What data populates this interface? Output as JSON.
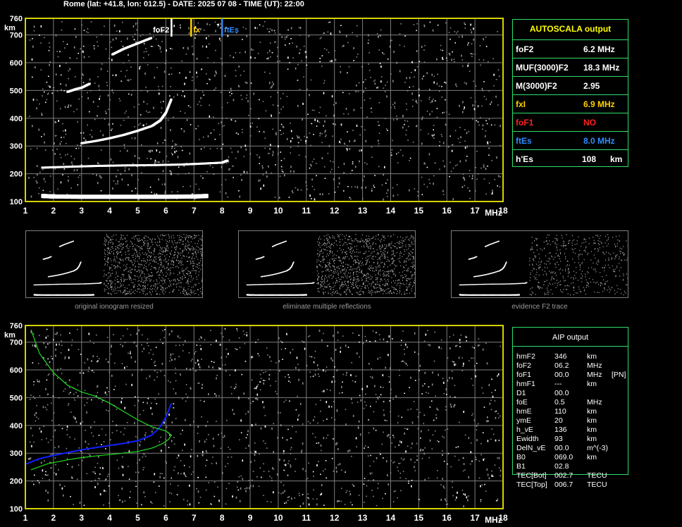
{
  "header": {
    "title": "Rome (lat: +41.8, lon: 012.5) - DATE: 2025 07 08 - TIME (UT): 22:00"
  },
  "colors": {
    "background": "#000000",
    "grid": "#7d7d7d",
    "axis_box": "#d6d200",
    "panel_border": "#2ee06a",
    "autoscala_title": "#ffff00",
    "fxI": "#ffd000",
    "foF1": "#ff2020",
    "ftEs": "#2f8bff",
    "profile_blue": "#1020ff",
    "profile_green": "#20e020",
    "trace": "#ffffff"
  },
  "chart_data": [
    {
      "type": "scatter",
      "name": "autoscala_ionogram",
      "xlabel": "MHz",
      "ylabel": "km",
      "xlim": [
        1,
        18
      ],
      "ylim": [
        100,
        760
      ],
      "xticks": [
        1,
        2,
        3,
        4,
        5,
        6,
        7,
        8,
        9,
        10,
        11,
        12,
        13,
        14,
        15,
        16,
        17,
        18
      ],
      "yticks": [
        100,
        200,
        300,
        400,
        500,
        600,
        700,
        760
      ],
      "grid": true,
      "markers": [
        {
          "label": "foF2",
          "x": 6.2,
          "color": "#ffffff"
        },
        {
          "label": "fx",
          "x": 6.9,
          "color": "#ffd000"
        },
        {
          "label": "ftEs",
          "x": 8.0,
          "color": "#2f8bff"
        }
      ],
      "traces": [
        {
          "name": "E/Es layer",
          "x": [
            1.6,
            2.0,
            3.0,
            4.0,
            5.0,
            6.0,
            7.0,
            7.5
          ],
          "y": [
            120,
            118,
            117,
            117,
            117,
            117,
            118,
            120
          ]
        },
        {
          "name": "Es second hop",
          "x": [
            1.6,
            2.5,
            3.5,
            4.5,
            5.5,
            6.5,
            7.2,
            8.0,
            8.2
          ],
          "y": [
            222,
            225,
            228,
            230,
            231,
            233,
            236,
            240,
            248
          ]
        },
        {
          "name": "F2 ordinary",
          "x": [
            3.0,
            3.5,
            4.0,
            4.5,
            5.0,
            5.5,
            5.8,
            6.0,
            6.2
          ],
          "y": [
            310,
            318,
            328,
            340,
            355,
            372,
            392,
            420,
            470
          ]
        },
        {
          "name": "F2 second hop",
          "x": [
            2.5,
            2.8,
            3.0,
            3.3
          ],
          "y": [
            495,
            505,
            510,
            525
          ]
        },
        {
          "name": "F2 faint high",
          "x": [
            4.1,
            4.5,
            5.0,
            5.5
          ],
          "y": [
            630,
            650,
            670,
            690
          ]
        }
      ]
    },
    {
      "type": "line",
      "name": "aip_profile",
      "xlabel": "MHz",
      "ylabel": "km",
      "xlim": [
        1,
        18
      ],
      "ylim": [
        100,
        760
      ],
      "xticks": [
        1,
        2,
        3,
        4,
        5,
        6,
        7,
        8,
        9,
        10,
        11,
        12,
        13,
        14,
        15,
        16,
        17,
        18
      ],
      "yticks": [
        100,
        200,
        300,
        400,
        500,
        600,
        700,
        760
      ],
      "grid": true,
      "series": [
        {
          "color": "blue",
          "x": [
            1.0,
            1.5,
            2.0,
            2.5,
            3.0,
            3.5,
            4.0,
            4.5,
            5.0,
            5.5,
            5.8,
            6.0,
            6.2
          ],
          "y": [
            260,
            280,
            292,
            302,
            312,
            320,
            328,
            335,
            345,
            365,
            395,
            430,
            480
          ]
        },
        {
          "color": "green",
          "x": [
            1.2,
            1.8,
            2.5,
            3.0,
            3.5,
            4.0,
            4.5,
            5.0,
            5.5,
            5.9,
            6.1,
            6.2,
            6.0,
            5.5,
            5.0,
            4.5,
            4.0,
            3.5,
            3.0,
            2.5,
            2.0,
            1.5,
            1.2
          ],
          "y": [
            240,
            262,
            276,
            284,
            290,
            295,
            300,
            306,
            318,
            335,
            350,
            365,
            380,
            395,
            420,
            450,
            480,
            505,
            520,
            545,
            590,
            660,
            745
          ]
        }
      ]
    }
  ],
  "autoscala": {
    "title": "AUTOSCALA output",
    "rows": [
      {
        "label": "foF2",
        "value": "6.2 MHz",
        "color": "#ffffff"
      },
      {
        "label": "MUF(3000)F2",
        "value": "18.3 MHz",
        "color": "#ffffff"
      },
      {
        "label": "M(3000)F2",
        "value": "2.95",
        "color": "#ffffff"
      },
      {
        "label": "fxI",
        "value": "6.9 MHz",
        "color": "#ffd000"
      },
      {
        "label": "foF1",
        "value": "NO",
        "color": "#ff2020"
      },
      {
        "label": "ftEs",
        "value": "8.0 MHz",
        "color": "#2f8bff"
      },
      {
        "label": "h'Es",
        "value": "108",
        "unit": "km",
        "color": "#ffffff"
      }
    ]
  },
  "thumbnails": [
    {
      "caption": "original ionogram resized"
    },
    {
      "caption": "eliminate multiple reflections"
    },
    {
      "caption": "evidence F2 trace"
    }
  ],
  "aip": {
    "title": "AIP output",
    "rows": [
      {
        "label": "hmF2",
        "value": "346",
        "unit": "km",
        "flag": ""
      },
      {
        "label": "foF2",
        "value": "06.2",
        "unit": "MHz",
        "flag": ""
      },
      {
        "label": "foF1",
        "value": "00.0",
        "unit": "MHz",
        "flag": "[PN]"
      },
      {
        "label": "hmF1",
        "value": "---",
        "unit": "km",
        "flag": ""
      },
      {
        "label": "D1",
        "value": "00.0",
        "unit": "",
        "flag": ""
      },
      {
        "label": "foE",
        "value": "0.5",
        "unit": "MHz",
        "flag": ""
      },
      {
        "label": "hmE",
        "value": "110",
        "unit": "km",
        "flag": ""
      },
      {
        "label": "ymE",
        "value": "20",
        "unit": "km",
        "flag": ""
      },
      {
        "label": "h_vE",
        "value": "136",
        "unit": "km",
        "flag": ""
      },
      {
        "label": "Ewidth",
        "value": "93",
        "unit": "km",
        "flag": ""
      },
      {
        "label": "DelN_vE",
        "value": "00.0",
        "unit": "m^(-3)",
        "flag": ""
      },
      {
        "label": "B0",
        "value": "069.0",
        "unit": "km",
        "flag": ""
      },
      {
        "label": "B1",
        "value": "02.8",
        "unit": "",
        "flag": ""
      },
      {
        "label": "TEC[Bot]",
        "value": "002.7",
        "unit": "TECU",
        "flag": ""
      },
      {
        "label": "TEC[Top]",
        "value": "006.7",
        "unit": "TECU",
        "flag": ""
      }
    ]
  }
}
